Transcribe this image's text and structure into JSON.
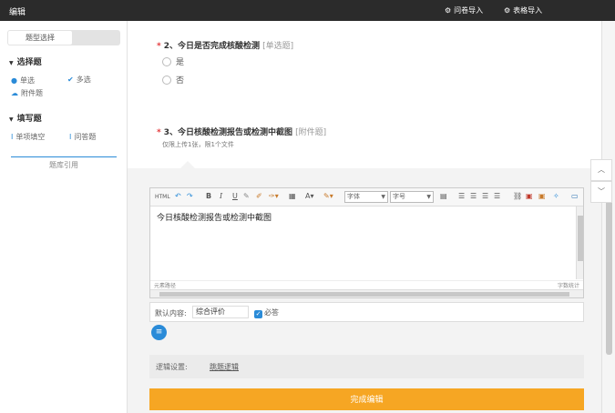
{
  "app": {
    "title": "编辑",
    "import_question_label": "问卷导入",
    "import_table_label": "表格导入"
  },
  "sidebar": {
    "tab_label": "题型选择",
    "section1_title": "选择题",
    "section1_items": [
      "单选",
      "多选",
      "附件题"
    ],
    "section2_title": "填写题",
    "section2_items": [
      "单项填空",
      "问答题"
    ],
    "more_label": "题库引用"
  },
  "question2": {
    "number_title": "2、今日是否完成核酸检测",
    "type_label": "[单选题]",
    "options": [
      "是",
      "否"
    ]
  },
  "question3": {
    "number_title": "3、今日核酸检测报告或检测中截图",
    "type_label": "[附件题]",
    "note": "仅限上传1张，限1个文件"
  },
  "editor": {
    "font_select": "字体",
    "size_select": "字号",
    "content": "今日核酸检测报告或检测中截图",
    "status_left": "元素路径",
    "status_right": "字数统计"
  },
  "field": {
    "label": "默认内容:",
    "value": "综合评价",
    "required_label": "必答"
  },
  "logic": {
    "label": "逻辑设置:",
    "link": "跳题逻辑"
  },
  "done_button": "完成编辑",
  "colors": {
    "accent": "#2a8bd8",
    "done": "#f6a623",
    "required": "#e4393c",
    "topbar": "#2b2b2b"
  }
}
